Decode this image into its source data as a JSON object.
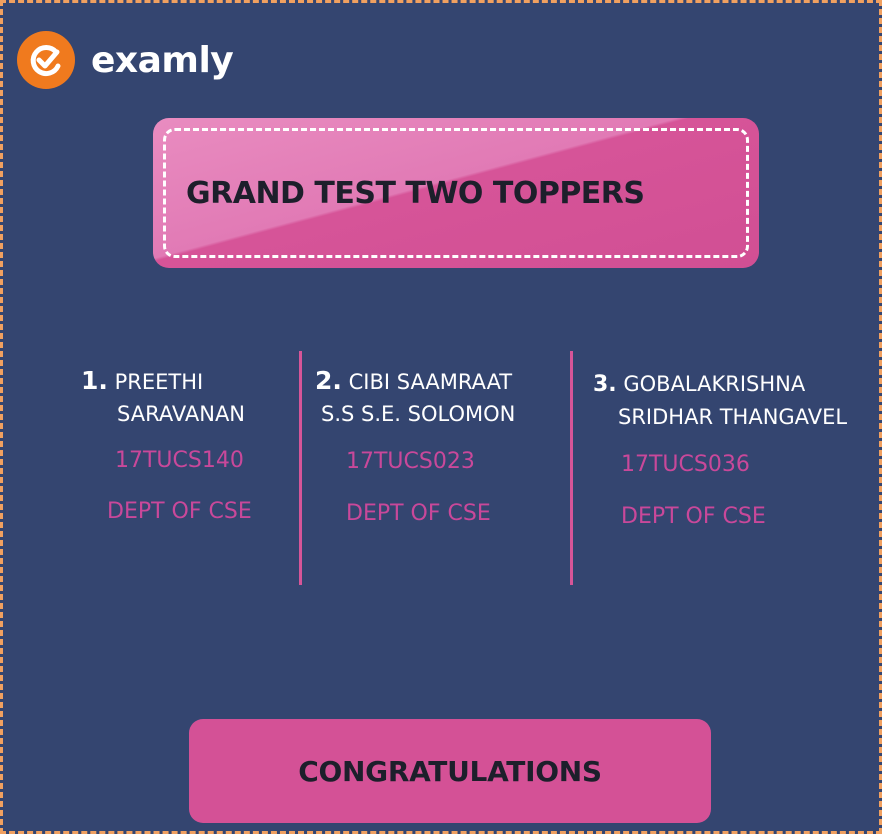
{
  "brand": {
    "name": "examly",
    "logo_icon": "examly-logo-icon",
    "logo_color": "#f07a1e"
  },
  "banner": {
    "title": "GRAND TEST TWO TOPPERS",
    "color": "#d65498"
  },
  "toppers": [
    {
      "rank": "1.",
      "name_line1": "PREETHI",
      "name_line2": "SARAVANAN",
      "id": "17TUCS140",
      "dept": "DEPT OF CSE"
    },
    {
      "rank": "2.",
      "name_line1": "CIBI SAAMRAAT",
      "name_line2": "S.S S.E. SOLOMON",
      "id": "17TUCS023",
      "dept": "DEPT OF CSE"
    },
    {
      "rank": "3.",
      "name_line1": "GOBALAKRISHNA",
      "name_line2": "SRIDHAR THANGAVEL",
      "id": "17TUCS036",
      "dept": "DEPT OF CSE"
    }
  ],
  "footer": {
    "label": "CONGRATULATIONS"
  },
  "colors": {
    "background": "#344570",
    "accent": "#d45196",
    "frame_border": "#f0a060"
  }
}
